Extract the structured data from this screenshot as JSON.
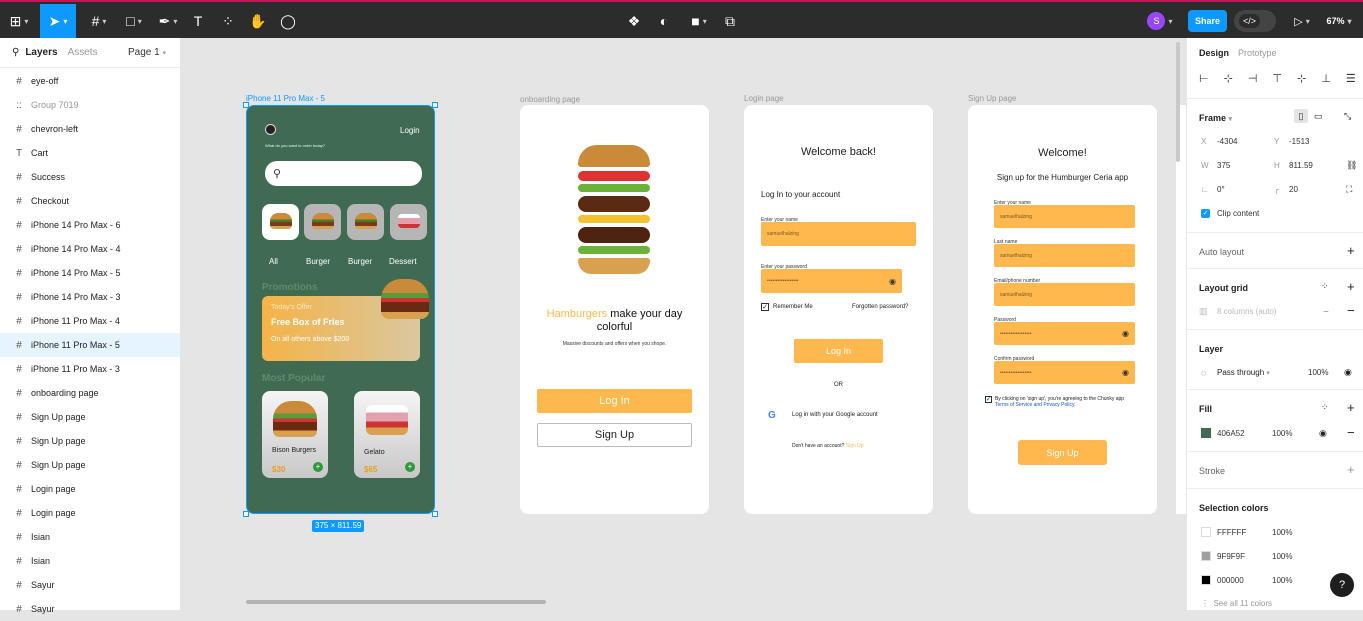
{
  "toolbar": {
    "zoom": "67%",
    "share": "Share",
    "avatar": "S"
  },
  "left_panel": {
    "tab_layers": "Layers",
    "tab_assets": "Assets",
    "page": "Page 1",
    "layers": [
      {
        "icon": "#",
        "label": "eye-off"
      },
      {
        "icon": "::",
        "label": "Group 7019"
      },
      {
        "icon": "#",
        "label": "chevron-left"
      },
      {
        "icon": "T",
        "label": "Cart"
      },
      {
        "icon": "#",
        "label": "Success"
      },
      {
        "icon": "#",
        "label": "Checkout"
      },
      {
        "icon": "#",
        "label": "iPhone 14 Pro Max - 6"
      },
      {
        "icon": "#",
        "label": "iPhone 14 Pro Max - 4"
      },
      {
        "icon": "#",
        "label": "iPhone 14 Pro Max - 5"
      },
      {
        "icon": "#",
        "label": "iPhone 14 Pro Max - 3"
      },
      {
        "icon": "#",
        "label": "iPhone 11 Pro Max - 4"
      },
      {
        "icon": "#",
        "label": "iPhone 11 Pro Max - 5"
      },
      {
        "icon": "#",
        "label": "iPhone 11 Pro Max - 3"
      },
      {
        "icon": "#",
        "label": "onboarding page"
      },
      {
        "icon": "#",
        "label": "Sign Up page"
      },
      {
        "icon": "#",
        "label": "Sign Up page"
      },
      {
        "icon": "#",
        "label": "Sign Up page"
      },
      {
        "icon": "#",
        "label": "Login page"
      },
      {
        "icon": "#",
        "label": "Login page"
      },
      {
        "icon": "#",
        "label": "Isian"
      },
      {
        "icon": "#",
        "label": "Isian"
      },
      {
        "icon": "#",
        "label": "Sayur"
      },
      {
        "icon": "#",
        "label": "Sayur"
      }
    ]
  },
  "canvas": {
    "frame1": {
      "label": "iPhone 11 Pro Max - 5",
      "size": "375 × 811.59",
      "login": "Login",
      "question": "What do you want to order today?",
      "cats": [
        "All",
        "Burger",
        "Burger",
        "Dessert"
      ],
      "promotions": "Promotions",
      "offer_small": "Today's Offer",
      "offer_title": "Free Box of Fries",
      "offer_sub": "On all others above $200",
      "most_popular": "Most Popular",
      "items": [
        {
          "name": "Bison Burgers",
          "price": "$30"
        },
        {
          "name": "Gelato",
          "price": "$65"
        }
      ]
    },
    "frame2": {
      "label": "onboarding page",
      "headline_accent": "Hamburgers",
      "headline_rest": " make your day colorful",
      "sub": "Massive discounts and offers when you shope.",
      "login_btn": "Log In",
      "signup_btn": "Sign Up"
    },
    "frame3": {
      "label": "Login page",
      "title": "Welcome back!",
      "subtitle": "Log In to your account",
      "name_label": "Enter your name",
      "name_value": "samuelhalzing",
      "pass_label": "Enter your password",
      "pass_value": "••••••••••••••••••",
      "remember": "Remember Me",
      "forgot": "Forgotten password?",
      "login_btn": "Log In",
      "or": "OR",
      "google": "Log in with your Google account",
      "no_account": "Don't have an account? ",
      "signup_link": "Sign Up"
    },
    "frame4": {
      "label": "Sign Up page",
      "title": "Welcome!",
      "subtitle": "Sign up for the Humburger Ceria app",
      "fields": [
        {
          "label": "Enter your name",
          "value": "samuelhalzing"
        },
        {
          "label": "Last name",
          "value": "samuelhalzing"
        },
        {
          "label": "Email/phone number",
          "value": "samuelhalzing"
        },
        {
          "label": "Password",
          "value": "••••••••••••••••••"
        },
        {
          "label": "Confirm password",
          "value": "••••••••••••••••••"
        }
      ],
      "terms": "By clicking on 'sign up', you're agreeing to the Chunky app",
      "terms2": "Terms of Service and Privacy Policy.",
      "btn": "Sign Up"
    }
  },
  "right_panel": {
    "tab_design": "Design",
    "tab_prototype": "Prototype",
    "frame": "Frame",
    "x_label": "X",
    "x": "-4304",
    "y_label": "Y",
    "y": "-1513",
    "w_label": "W",
    "w": "375",
    "h_label": "H",
    "h": "811.59",
    "rotation": "0°",
    "radius": "20",
    "clip": "Clip content",
    "auto_layout": "Auto layout",
    "layout_grid": "Layout grid",
    "grid_hint": "8 columns (auto)",
    "layer": "Layer",
    "blend": "Pass through",
    "layer_opacity": "100%",
    "fill": "Fill",
    "fill_hex": "406A52",
    "fill_opacity": "100%",
    "stroke": "Stroke",
    "selection_colors": "Selection colors",
    "colors": [
      {
        "hex": "FFFFFF",
        "opacity": "100%",
        "swatch": "#ffffff"
      },
      {
        "hex": "9F9F9F",
        "opacity": "100%",
        "swatch": "#9f9f9f"
      },
      {
        "hex": "000000",
        "opacity": "100%",
        "swatch": "#000000"
      }
    ],
    "see_all": "See all 11 colors",
    "help": "?"
  },
  "colors": {
    "frame_green": "#406a52",
    "accent_orange": "#ffb84d",
    "selection_blue": "#0d99ff"
  }
}
